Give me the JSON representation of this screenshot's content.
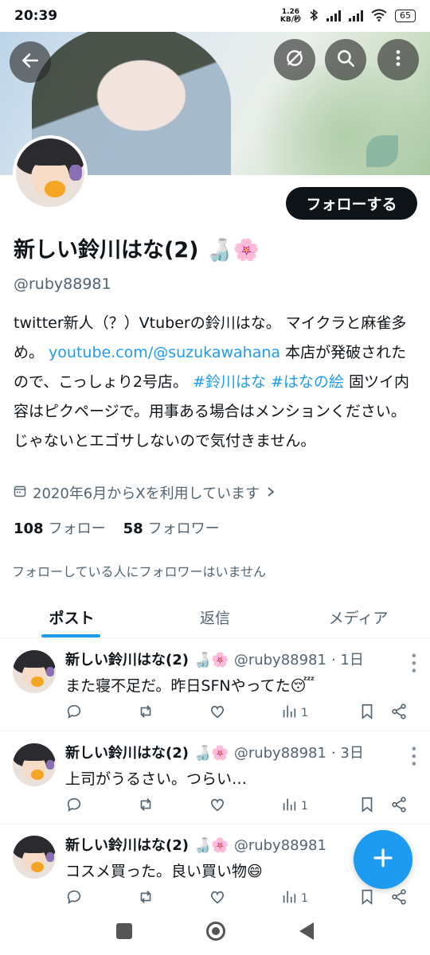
{
  "status_bar": {
    "time": "20:39",
    "net_speed": "1.26",
    "net_unit": "KB/秒",
    "battery": "65"
  },
  "header": {
    "back_icon": "arrow-left-icon",
    "grok_icon": "no-symbol-icon",
    "search_icon": "search-icon",
    "more_icon": "more-vertical-icon"
  },
  "profile": {
    "follow_label": "フォローする",
    "display_name": "新しい鈴川はな(2)",
    "name_emoji": "🍶🌸",
    "handle": "@ruby88981",
    "bio": {
      "p1": "twitter新人（？）Vtuberの鈴川はな。 マイクラと麻雀多め。 ",
      "link1": "youtube.com/@suzukawahana",
      "p2": " 本店が発破されたので、こっしょり2号店。 ",
      "link2": "#鈴川はな",
      "p3": " ",
      "link3": "#はなの絵",
      "p4": " 固ツイ内容はピクページで。用事ある場合はメンションください。じゃないとエゴサしないので気付きません。"
    },
    "joined": "2020年6月からXを利用しています",
    "following_count": "108",
    "following_label": "フォロー",
    "followers_count": "58",
    "followers_label": "フォロワー",
    "no_mutual_followers": "フォローしている人にフォロワーはいません"
  },
  "tabs": [
    {
      "label": "ポスト",
      "active": true
    },
    {
      "label": "返信",
      "active": false
    },
    {
      "label": "メディア",
      "active": false
    }
  ],
  "posts": [
    {
      "name": "新しい鈴川はな(2)",
      "emoji": "🍶🌸",
      "handle": "@ruby88981",
      "time": "· 1日",
      "text": "また寝不足だ。昨日SFNやってた😴",
      "views": "1"
    },
    {
      "name": "新しい鈴川はな(2)",
      "emoji": "🍶🌸",
      "handle": "@ruby88981",
      "time": "· 3日",
      "text": "上司がうるさい。つらい…",
      "views": "1"
    },
    {
      "name": "新しい鈴川はな(2)",
      "emoji": "🍶🌸",
      "handle": "@ruby88981",
      "time": "",
      "text": "コスメ買った。良い買い物😄",
      "views": "1"
    }
  ],
  "fab": {
    "icon": "plus-icon"
  },
  "colors": {
    "accent": "#1d9bf0",
    "text": "#0f1419",
    "muted": "#536471"
  }
}
